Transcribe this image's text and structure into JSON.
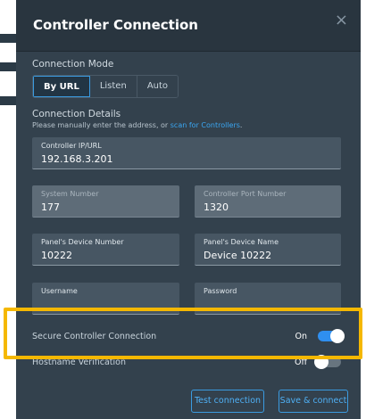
{
  "dialog": {
    "title": "Controller Connection",
    "close_icon": "×"
  },
  "connection_mode": {
    "label": "Connection Mode",
    "options": [
      "By URL",
      "Listen",
      "Auto"
    ],
    "selected": "By URL"
  },
  "connection_details": {
    "label": "Connection Details",
    "hint_prefix": "Please manually enter the address, or ",
    "hint_link": "scan for Controllers",
    "hint_suffix": "."
  },
  "fields": {
    "controller_ip": {
      "label": "Controller IP/URL",
      "value": "192.168.3.201"
    },
    "system_number": {
      "label": "System Number",
      "value": "177"
    },
    "controller_port": {
      "label": "Controller Port Number",
      "value": "1320"
    },
    "device_number": {
      "label": "Panel's Device Number",
      "value": "10222"
    },
    "device_name": {
      "label": "Panel's Device Name",
      "value": "Device 10222"
    },
    "username": {
      "label": "Username",
      "value": ""
    },
    "password": {
      "label": "Password",
      "value": ""
    }
  },
  "toggles": {
    "secure": {
      "label": "Secure Controller Connection",
      "state": "On"
    },
    "hostname": {
      "label": "Hostname Verification",
      "state": "Off"
    }
  },
  "footer": {
    "test_label": "Test connection",
    "save_label": "Save & connect"
  },
  "colors": {
    "dialog_bg": "#33414d",
    "accent": "#2f8ff0",
    "highlight": "#f5b800"
  }
}
